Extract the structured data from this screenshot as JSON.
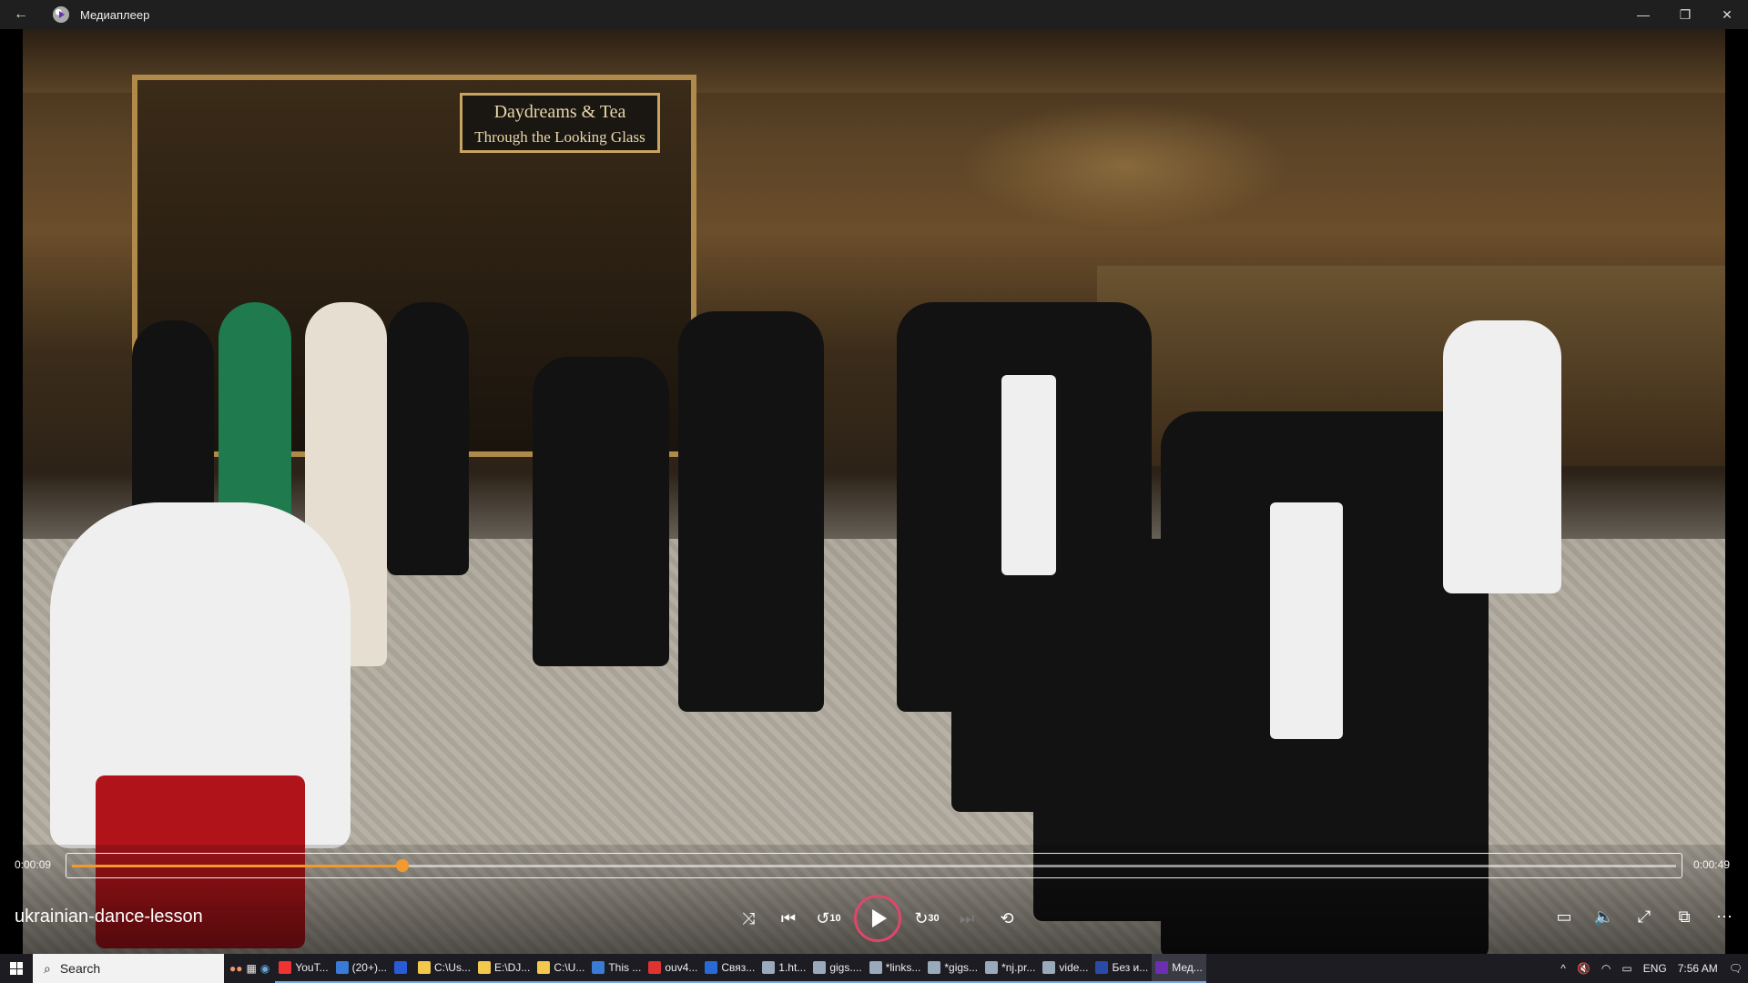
{
  "window": {
    "app_title": "Медиаплеер"
  },
  "video_frame": {
    "sign_line1": "Daydreams & Tea",
    "sign_line2": "Through the Looking Glass"
  },
  "player": {
    "current_time": "0:00:09",
    "total_time": "0:00:49",
    "progress_fraction": 0.206,
    "file_name": "ukrainian-dance-lesson",
    "skip_back_label": "10",
    "skip_forward_label": "30",
    "accent_color": "#f39a2e",
    "play_ring_color": "#e0466a"
  },
  "taskbar": {
    "search_placeholder": "Search",
    "tasks": [
      {
        "label": "YouT...",
        "color": "#e33"
      },
      {
        "label": "(20+)...",
        "color": "#3b7bd8"
      },
      {
        "label": "",
        "color": "#2a5bd7"
      },
      {
        "label": "C:\\Us...",
        "color": "#f2c94c"
      },
      {
        "label": "E:\\DJ...",
        "color": "#f2c94c"
      },
      {
        "label": "C:\\U...",
        "color": "#f2c94c"
      },
      {
        "label": "This ...",
        "color": "#3a7bd5"
      },
      {
        "label": "ouv4...",
        "color": "#d33"
      },
      {
        "label": "Связ...",
        "color": "#2a6ad6"
      },
      {
        "label": "1.ht...",
        "color": "#9ab"
      },
      {
        "label": "gigs....",
        "color": "#9ab"
      },
      {
        "label": "*links...",
        "color": "#9ab"
      },
      {
        "label": "*gigs...",
        "color": "#9ab"
      },
      {
        "label": "*nj.pr...",
        "color": "#9ab"
      },
      {
        "label": "vide...",
        "color": "#9ab"
      },
      {
        "label": "Без и...",
        "color": "#2a4aa7"
      },
      {
        "label": "Мед...",
        "color": "#6b2fb3"
      }
    ],
    "lang": "ENG",
    "clock": "7:56 AM"
  }
}
